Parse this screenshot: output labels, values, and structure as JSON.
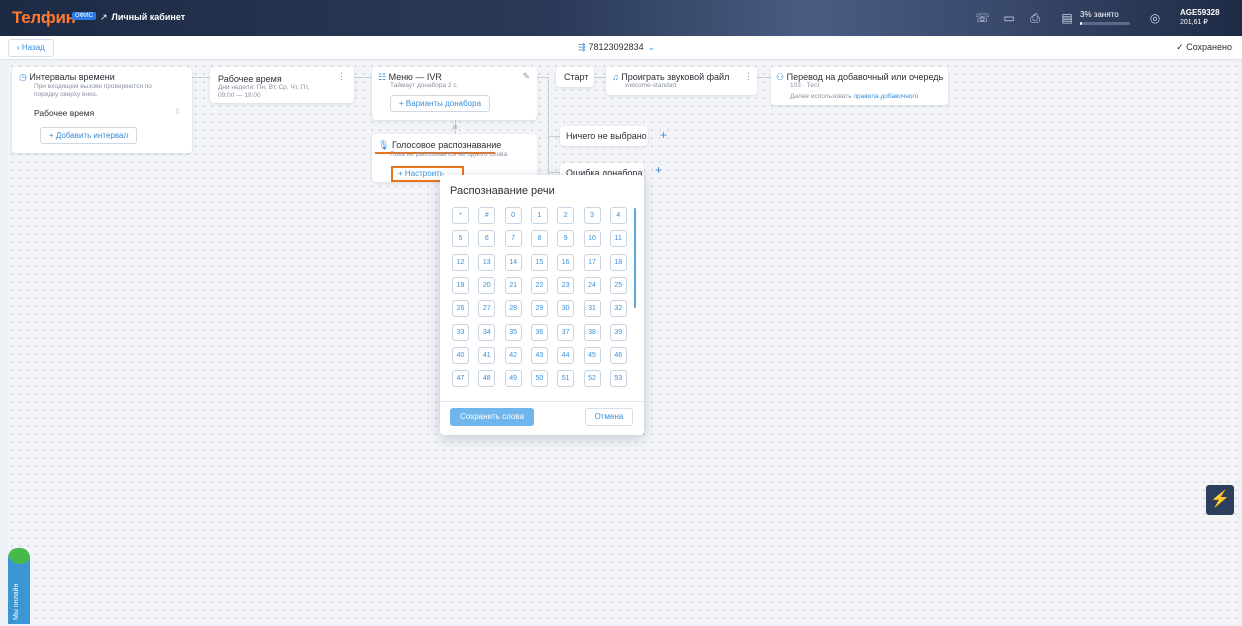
{
  "topbar": {
    "logo": "Телфин",
    "logo_badge": "ОФИС",
    "cabinet": "Личный кабинет",
    "cabinet_icon": "external-link-icon",
    "icons": [
      "phone-icon",
      "chat-icon",
      "printer-icon",
      "storage-icon"
    ],
    "busy_label": "3% занято",
    "busy_percent": 3,
    "account_id": "AGE59328",
    "balance": "201,61 ₽"
  },
  "subbar": {
    "back": "Назад",
    "phone": "78123092834",
    "saved": "Сохранено"
  },
  "cards": {
    "intervals": {
      "title": "Интервалы времени",
      "subtitle": "При входящем вызове проверяются по порядку сверху вниз.",
      "item": "Рабочее время",
      "add": "Добавить интервал"
    },
    "worktime": {
      "title": "Рабочее время",
      "subtitle": "Дни недели: Пн, Вт, Ср, Чт, Пт,",
      "hours": "09:00 — 19:00"
    },
    "ivr": {
      "title": "Меню — IVR",
      "subtitle": "Таймаут донабора 2 с.",
      "options": "Варианты донабора"
    },
    "and_label": "и",
    "voice": {
      "title": "Голосовое распознавание",
      "subtitle": "Пока не распознается ни одного слова",
      "configure": "Настроить"
    },
    "start": "Старт",
    "play": {
      "title": "Проиграть звуковой файл",
      "subtitle": "welcome-standart"
    },
    "transfer": {
      "title": "Перевод на добавочный или очередь",
      "subtitle": "103 · Тест",
      "rules_prefix": "Далее использовать",
      "rules_link": "правила добавочного"
    },
    "nothing_selected": "Ничего не выбрано",
    "dial_error": "Ошибка донабора"
  },
  "popup": {
    "title": "Распознавание речи",
    "keys": [
      "*",
      "#",
      "0",
      "1",
      "2",
      "3",
      "4",
      "5",
      "6",
      "7",
      "8",
      "9",
      "10",
      "11",
      "12",
      "13",
      "14",
      "15",
      "16",
      "17",
      "18",
      "19",
      "20",
      "21",
      "22",
      "23",
      "24",
      "25",
      "26",
      "27",
      "28",
      "29",
      "30",
      "31",
      "32",
      "33",
      "34",
      "35",
      "36",
      "37",
      "38",
      "39",
      "40",
      "41",
      "42",
      "43",
      "44",
      "45",
      "46",
      "47",
      "48",
      "49",
      "50",
      "51",
      "52",
      "53"
    ],
    "save": "Сохранить слова",
    "cancel": "Отмена"
  },
  "chat": {
    "label": "Мы онлайн"
  },
  "colors": {
    "accent": "#3a8fd9",
    "brand": "#ff7a2f",
    "highlight": "#e8731d"
  }
}
